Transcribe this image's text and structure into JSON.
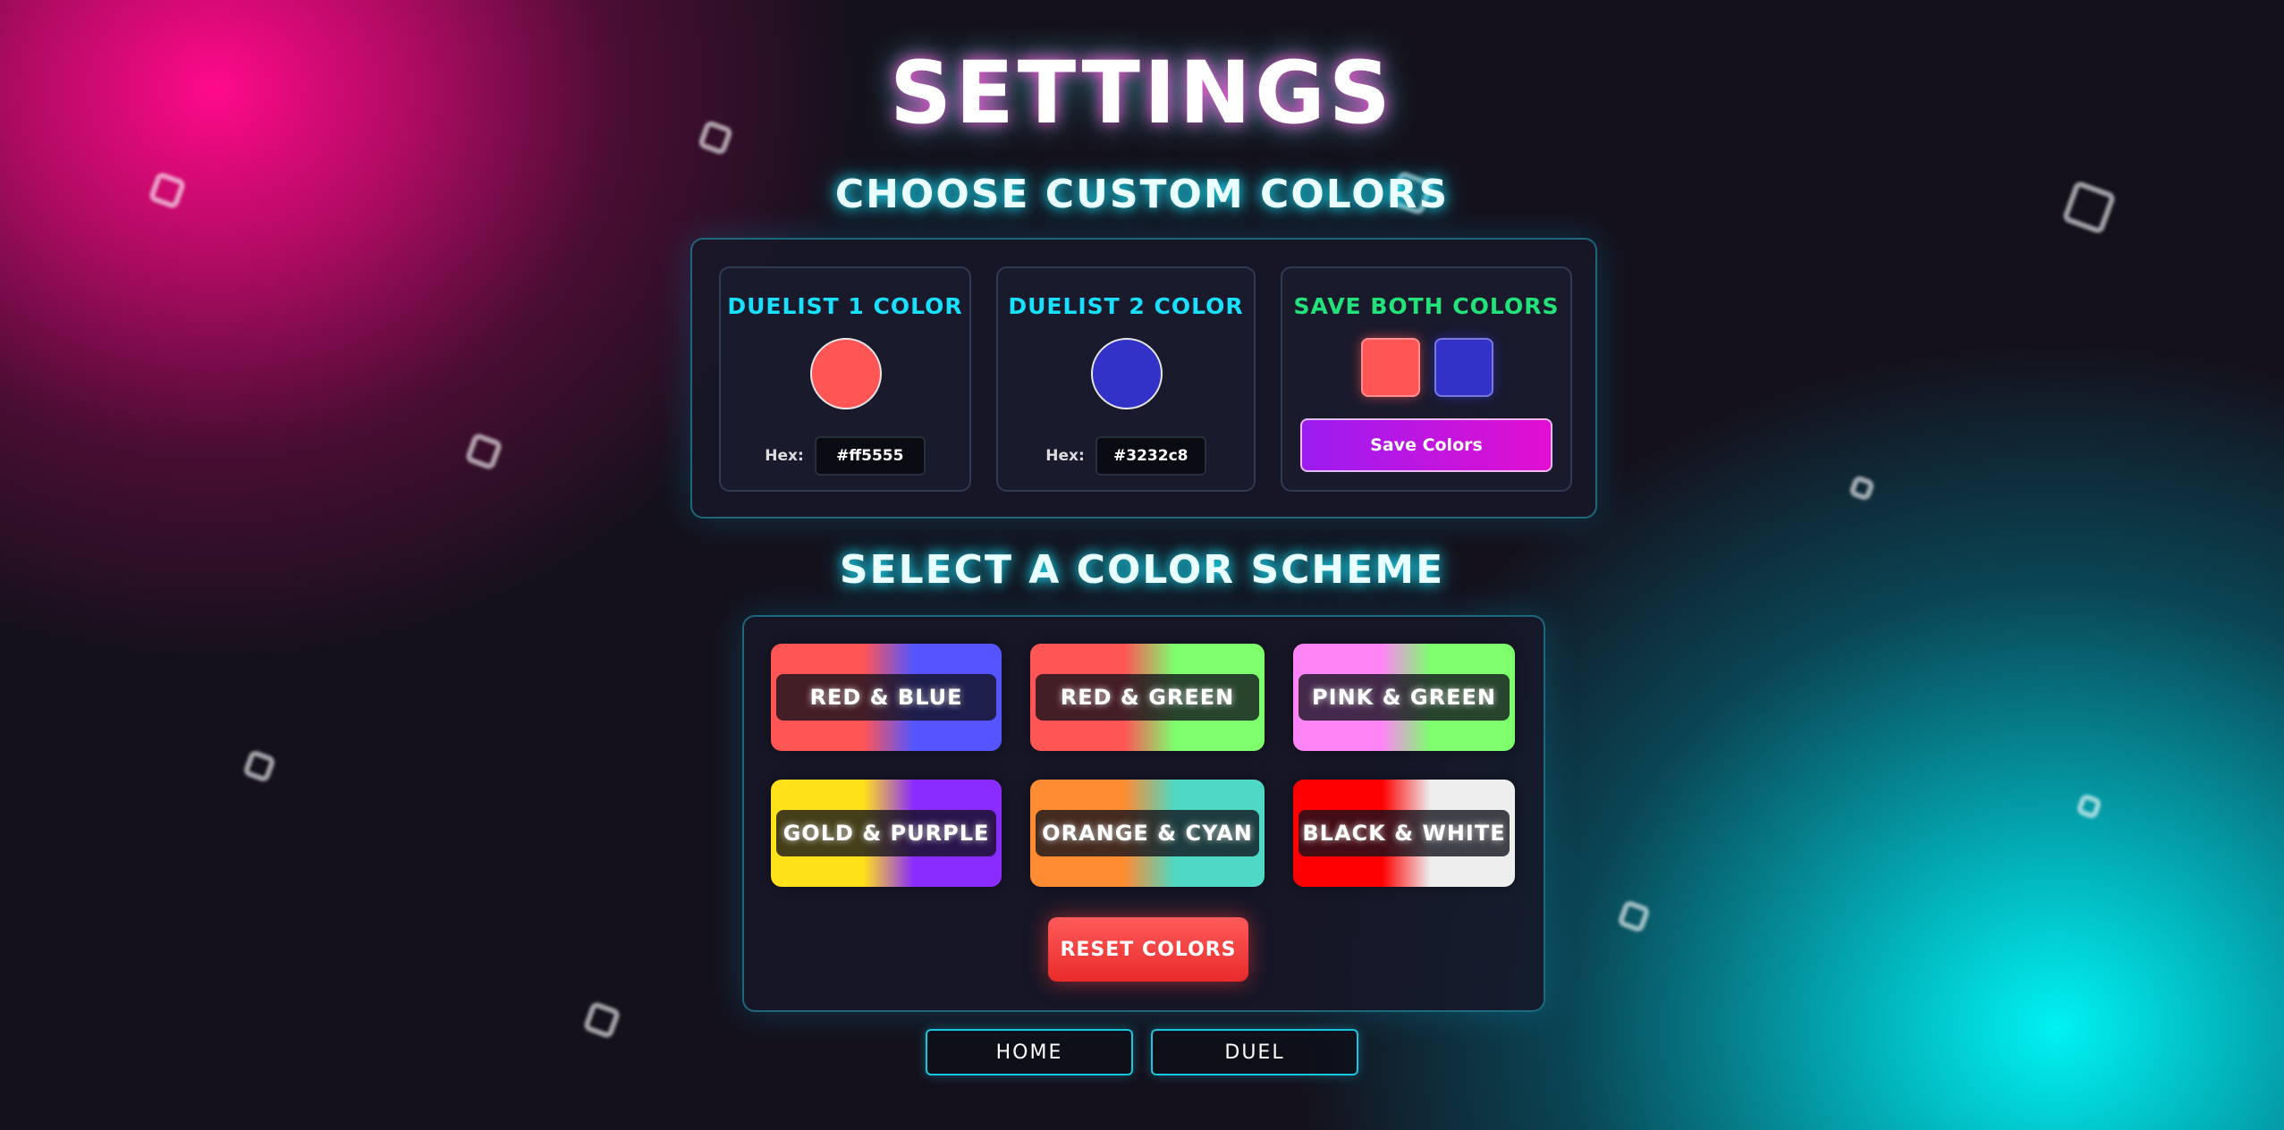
{
  "page": {
    "title": "SETTINGS"
  },
  "custom": {
    "heading": "CHOOSE CUSTOM COLORS",
    "duelist1": {
      "title": "DUELIST 1 COLOR",
      "hex_label": "Hex:",
      "hex": "#ff5555",
      "color": "#ff5555"
    },
    "duelist2": {
      "title": "DUELIST 2 COLOR",
      "hex_label": "Hex:",
      "hex": "#3232c8",
      "color": "#3232c8"
    },
    "save": {
      "title": "SAVE BOTH COLORS",
      "button": "Save Colors"
    }
  },
  "schemes": {
    "heading": "SELECT A COLOR SCHEME",
    "items": [
      {
        "label": "RED & BLUE",
        "left": "#ff5555",
        "right": "#5555ff"
      },
      {
        "label": "RED & GREEN",
        "left": "#ff5555",
        "right": "#7dff6e"
      },
      {
        "label": "PINK & GREEN",
        "left": "#ff85f7",
        "right": "#7dff6e"
      },
      {
        "label": "GOLD & PURPLE",
        "left": "#ffe21a",
        "right": "#8a2bff"
      },
      {
        "label": "ORANGE & CYAN",
        "left": "#ff8c33",
        "right": "#4dd9c4"
      },
      {
        "label": "BLACK & WHITE",
        "left": "#ff0000",
        "right": "#eeeeee"
      }
    ],
    "reset": "RESET COLORS"
  },
  "nav": {
    "home": "HOME",
    "duel": "DUEL"
  }
}
